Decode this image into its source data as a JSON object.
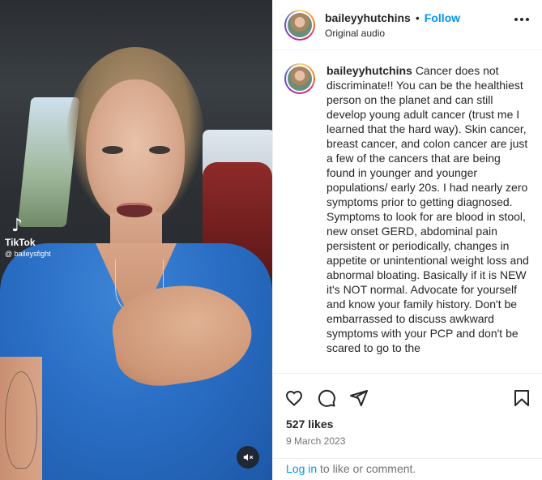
{
  "post": {
    "username": "baileyyhutchins",
    "follow_label": "Follow",
    "dot": "•",
    "audio_label": "Original audio",
    "caption": "Cancer does not discriminate!! You can be the healthiest person on the planet and can still develop young adult cancer (trust me I learned that the hard way). Skin cancer, breast cancer, and colon cancer are just a few of the cancers that are being found in younger and younger populations/ early 20s. I had nearly zero symptoms prior to getting diagnosed. Symptoms to look for are blood in stool, new onset GERD, abdominal pain persistent or periodically, changes in appetite or unintentional weight loss and abnormal bloating. Basically if it is NEW it's NOT normal. Advocate for yourself and know your family history. Don't be embarrassed to discuss awkward symptoms with your PCP and don't be scared to go to the",
    "likes": "527 likes",
    "date": "9 March 2023"
  },
  "video": {
    "watermark_brand": "TikTok",
    "watermark_handle": "@ baileysfight"
  },
  "login_prompt": {
    "link": "Log in",
    "text": " to like or comment."
  },
  "icons": {
    "like": "heart-icon",
    "comment": "comment-icon",
    "share": "share-icon",
    "save": "bookmark-icon",
    "more": "more-options-icon",
    "mute": "muted-speaker-icon"
  },
  "colors": {
    "accent": "#0095f6",
    "muted_text": "#737373",
    "text": "#262626",
    "scrubs_blue": "#2a6fc5"
  }
}
